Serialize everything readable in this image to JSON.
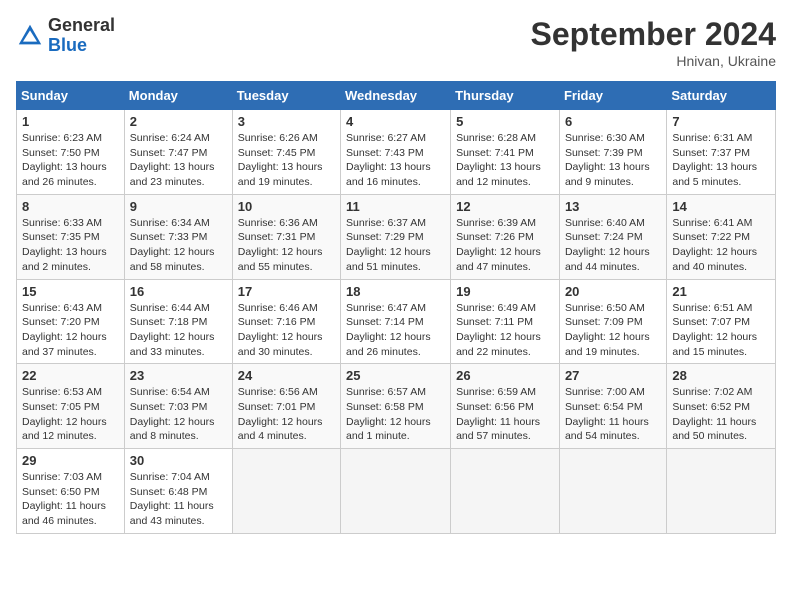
{
  "header": {
    "logo_general": "General",
    "logo_blue": "Blue",
    "month_title": "September 2024",
    "location": "Hnivan, Ukraine"
  },
  "weekdays": [
    "Sunday",
    "Monday",
    "Tuesday",
    "Wednesday",
    "Thursday",
    "Friday",
    "Saturday"
  ],
  "weeks": [
    [
      {
        "day": "1",
        "info": "Sunrise: 6:23 AM\nSunset: 7:50 PM\nDaylight: 13 hours\nand 26 minutes."
      },
      {
        "day": "2",
        "info": "Sunrise: 6:24 AM\nSunset: 7:47 PM\nDaylight: 13 hours\nand 23 minutes."
      },
      {
        "day": "3",
        "info": "Sunrise: 6:26 AM\nSunset: 7:45 PM\nDaylight: 13 hours\nand 19 minutes."
      },
      {
        "day": "4",
        "info": "Sunrise: 6:27 AM\nSunset: 7:43 PM\nDaylight: 13 hours\nand 16 minutes."
      },
      {
        "day": "5",
        "info": "Sunrise: 6:28 AM\nSunset: 7:41 PM\nDaylight: 13 hours\nand 12 minutes."
      },
      {
        "day": "6",
        "info": "Sunrise: 6:30 AM\nSunset: 7:39 PM\nDaylight: 13 hours\nand 9 minutes."
      },
      {
        "day": "7",
        "info": "Sunrise: 6:31 AM\nSunset: 7:37 PM\nDaylight: 13 hours\nand 5 minutes."
      }
    ],
    [
      {
        "day": "8",
        "info": "Sunrise: 6:33 AM\nSunset: 7:35 PM\nDaylight: 13 hours\nand 2 minutes."
      },
      {
        "day": "9",
        "info": "Sunrise: 6:34 AM\nSunset: 7:33 PM\nDaylight: 12 hours\nand 58 minutes."
      },
      {
        "day": "10",
        "info": "Sunrise: 6:36 AM\nSunset: 7:31 PM\nDaylight: 12 hours\nand 55 minutes."
      },
      {
        "day": "11",
        "info": "Sunrise: 6:37 AM\nSunset: 7:29 PM\nDaylight: 12 hours\nand 51 minutes."
      },
      {
        "day": "12",
        "info": "Sunrise: 6:39 AM\nSunset: 7:26 PM\nDaylight: 12 hours\nand 47 minutes."
      },
      {
        "day": "13",
        "info": "Sunrise: 6:40 AM\nSunset: 7:24 PM\nDaylight: 12 hours\nand 44 minutes."
      },
      {
        "day": "14",
        "info": "Sunrise: 6:41 AM\nSunset: 7:22 PM\nDaylight: 12 hours\nand 40 minutes."
      }
    ],
    [
      {
        "day": "15",
        "info": "Sunrise: 6:43 AM\nSunset: 7:20 PM\nDaylight: 12 hours\nand 37 minutes."
      },
      {
        "day": "16",
        "info": "Sunrise: 6:44 AM\nSunset: 7:18 PM\nDaylight: 12 hours\nand 33 minutes."
      },
      {
        "day": "17",
        "info": "Sunrise: 6:46 AM\nSunset: 7:16 PM\nDaylight: 12 hours\nand 30 minutes."
      },
      {
        "day": "18",
        "info": "Sunrise: 6:47 AM\nSunset: 7:14 PM\nDaylight: 12 hours\nand 26 minutes."
      },
      {
        "day": "19",
        "info": "Sunrise: 6:49 AM\nSunset: 7:11 PM\nDaylight: 12 hours\nand 22 minutes."
      },
      {
        "day": "20",
        "info": "Sunrise: 6:50 AM\nSunset: 7:09 PM\nDaylight: 12 hours\nand 19 minutes."
      },
      {
        "day": "21",
        "info": "Sunrise: 6:51 AM\nSunset: 7:07 PM\nDaylight: 12 hours\nand 15 minutes."
      }
    ],
    [
      {
        "day": "22",
        "info": "Sunrise: 6:53 AM\nSunset: 7:05 PM\nDaylight: 12 hours\nand 12 minutes."
      },
      {
        "day": "23",
        "info": "Sunrise: 6:54 AM\nSunset: 7:03 PM\nDaylight: 12 hours\nand 8 minutes."
      },
      {
        "day": "24",
        "info": "Sunrise: 6:56 AM\nSunset: 7:01 PM\nDaylight: 12 hours\nand 4 minutes."
      },
      {
        "day": "25",
        "info": "Sunrise: 6:57 AM\nSunset: 6:58 PM\nDaylight: 12 hours\nand 1 minute."
      },
      {
        "day": "26",
        "info": "Sunrise: 6:59 AM\nSunset: 6:56 PM\nDaylight: 11 hours\nand 57 minutes."
      },
      {
        "day": "27",
        "info": "Sunrise: 7:00 AM\nSunset: 6:54 PM\nDaylight: 11 hours\nand 54 minutes."
      },
      {
        "day": "28",
        "info": "Sunrise: 7:02 AM\nSunset: 6:52 PM\nDaylight: 11 hours\nand 50 minutes."
      }
    ],
    [
      {
        "day": "29",
        "info": "Sunrise: 7:03 AM\nSunset: 6:50 PM\nDaylight: 11 hours\nand 46 minutes."
      },
      {
        "day": "30",
        "info": "Sunrise: 7:04 AM\nSunset: 6:48 PM\nDaylight: 11 hours\nand 43 minutes."
      },
      {
        "day": "",
        "info": ""
      },
      {
        "day": "",
        "info": ""
      },
      {
        "day": "",
        "info": ""
      },
      {
        "day": "",
        "info": ""
      },
      {
        "day": "",
        "info": ""
      }
    ]
  ]
}
